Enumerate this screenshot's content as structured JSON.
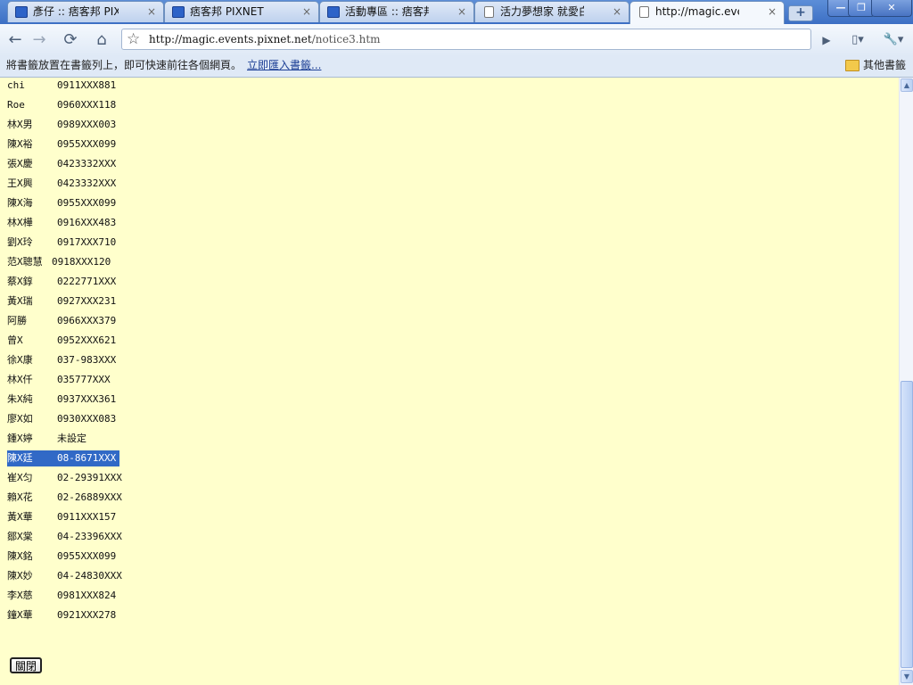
{
  "tabs": [
    {
      "label": "彥仔 :: 痞客邦 PIXNE...",
      "close": "×",
      "icon": "pixnet-icon"
    },
    {
      "label": "痞客邦 PIXNET",
      "close": "×",
      "icon": "pixnet-icon"
    },
    {
      "label": "活動專區 :: 痞客邦 PI...",
      "close": "×",
      "icon": "pixnet-icon"
    },
    {
      "label": "活力夢想家 就愛白花油",
      "close": "×",
      "icon": "page-icon"
    },
    {
      "label": "http://magic.events.pixn...",
      "close": "×",
      "icon": "page-icon"
    }
  ],
  "new_tab": "+",
  "window_buttons": {
    "minimize": "—",
    "maximize": "❐",
    "close": "✕"
  },
  "toolbar": {
    "back": "←",
    "forward": "→",
    "reload": "⟳",
    "home": "⌂",
    "star": "☆",
    "url_domain": "http://magic.events.pixnet.net",
    "url_path": "/notice3.htm",
    "go": "▶",
    "page_menu": "▯▾",
    "wrench_menu": "🔧▾"
  },
  "bookmarks": {
    "hint": "將書籤放置在書籤列上，即可快速前往各個網頁。",
    "import_link": "立即匯入書籤...",
    "other": "其他書籤"
  },
  "winners": [
    {
      "name": "chi",
      "phone": "0911XXX881"
    },
    {
      "name": "Roe",
      "phone": "0960XXX118"
    },
    {
      "name": "林X男",
      "phone": "0989XXX003"
    },
    {
      "name": "陳X裕",
      "phone": "0955XXX099"
    },
    {
      "name": "張X慶",
      "phone": "0423332XXX"
    },
    {
      "name": "王X興",
      "phone": "0423332XXX"
    },
    {
      "name": "陳X海",
      "phone": "0955XXX099"
    },
    {
      "name": "林X樺",
      "phone": "0916XXX483"
    },
    {
      "name": "劉X玲",
      "phone": "0917XXX710"
    },
    {
      "name": "范X聰慧",
      "phone": "0918XXX120"
    },
    {
      "name": "蔡X錞",
      "phone": "0222771XXX"
    },
    {
      "name": "黃X瑞",
      "phone": "0927XXX231"
    },
    {
      "name": "阿勝",
      "phone": "0966XXX379"
    },
    {
      "name": "曾X",
      "phone": "0952XXX621"
    },
    {
      "name": "徐X康",
      "phone": "037-983XXX"
    },
    {
      "name": "林X仟",
      "phone": "035777XXX"
    },
    {
      "name": "朱X純",
      "phone": "0937XXX361"
    },
    {
      "name": "廖X如",
      "phone": "0930XXX083"
    },
    {
      "name": "鍾X婷",
      "phone": "未設定"
    },
    {
      "name": "陳X廷",
      "phone": "08-8671XXX"
    },
    {
      "name": "崔X匀",
      "phone": "02-29391XXX"
    },
    {
      "name": "賴X花",
      "phone": "02-26889XXX"
    },
    {
      "name": "黃X華",
      "phone": "0911XXX157"
    },
    {
      "name": "鄒X棠",
      "phone": "04-23396XXX"
    },
    {
      "name": "陳X銘",
      "phone": "0955XXX099"
    },
    {
      "name": "陳X妙",
      "phone": "04-24830XXX"
    },
    {
      "name": "李X慈",
      "phone": "0981XXX824"
    },
    {
      "name": "鐘X華",
      "phone": "0921XXX278"
    }
  ],
  "selected_row": 19,
  "close_button": "關閉",
  "scrollbar": {
    "up": "▲",
    "down": "▼"
  }
}
